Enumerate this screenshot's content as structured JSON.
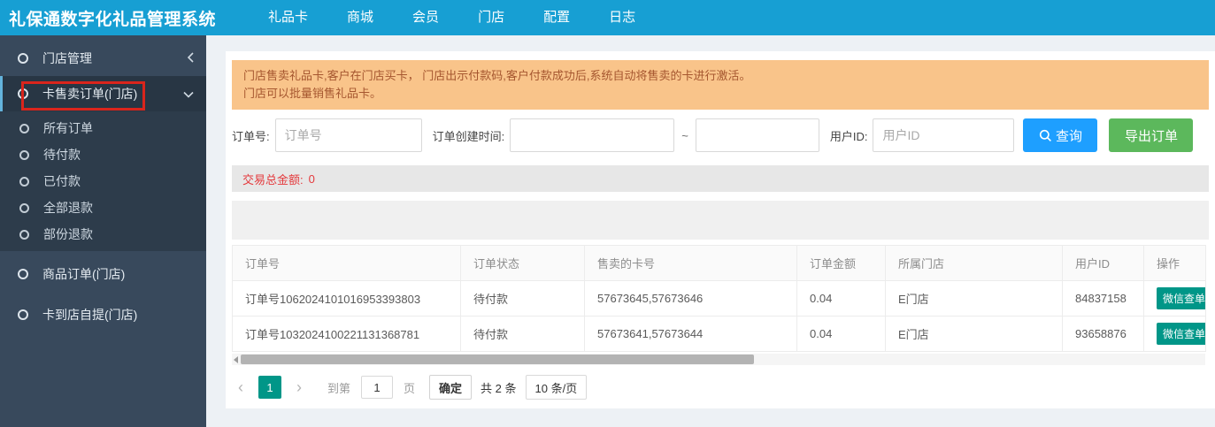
{
  "header": {
    "title": "礼保通数字化礼品管理系统",
    "nav": [
      {
        "label": "礼品卡"
      },
      {
        "label": "商城"
      },
      {
        "label": "会员"
      },
      {
        "label": "门店"
      },
      {
        "label": "配置"
      },
      {
        "label": "日志"
      }
    ]
  },
  "sidebar": {
    "store_manage": "门店管理",
    "card_sell_orders": "卡售卖订单(门店)",
    "submenu": [
      {
        "label": "所有订单"
      },
      {
        "label": "待付款"
      },
      {
        "label": "已付款"
      },
      {
        "label": "全部退款"
      },
      {
        "label": "部份退款"
      }
    ],
    "goods_orders": "商品订单(门店)",
    "card_pickup": "卡到店自提(门店)"
  },
  "notice": {
    "line1": "门店售卖礼品卡,客户在门店买卡， 门店出示付款码,客户付款成功后,系统自动将售卖的卡进行激活。",
    "line2": "门店可以批量销售礼品卡。"
  },
  "filters": {
    "order_no_label": "订单号:",
    "order_no_placeholder": "订单号",
    "created_label": "订单创建时间:",
    "range_separator": "~",
    "user_id_label": "用户ID:",
    "user_id_placeholder": "用户ID",
    "search_button": "查询",
    "export_button": "导出订单"
  },
  "summary": {
    "label": "交易总金额:",
    "value": "0"
  },
  "table": {
    "columns": [
      "订单号",
      "订单状态",
      "售卖的卡号",
      "订单金额",
      "所属门店",
      "用户ID",
      "操作"
    ],
    "rows": [
      {
        "order_no": "订单号1062024101016953393803",
        "status": "待付款",
        "cards": "57673645,57673646",
        "amount": "0.04",
        "store": "E门店",
        "user_id": "84837158",
        "action": "微信查单"
      },
      {
        "order_no": "订单号1032024100221131368781",
        "status": "待付款",
        "cards": "57673641,57673644",
        "amount": "0.04",
        "store": "E门店",
        "user_id": "93658876",
        "action": "微信查单"
      }
    ]
  },
  "pagination": {
    "prev": "‹",
    "current_page": "1",
    "next": "›",
    "goto_label": "到第",
    "goto_value": "1",
    "page_unit": "页",
    "confirm_button": "确定",
    "total_text": "共 2 条",
    "page_size": "10 条/页"
  },
  "colors": {
    "header_bg": "#179fd3",
    "sidebar_bg": "#38495c",
    "submenu_bg": "#2d3c4b",
    "active_accent": "#63b3dc",
    "annotation_red": "#da251c",
    "banner_bg": "#f9c48a",
    "banner_text": "#a5562f",
    "search_blue": "#1e9fff",
    "export_green": "#5cb85c",
    "teal_green": "#009688",
    "amount_red": "#e4393c"
  }
}
